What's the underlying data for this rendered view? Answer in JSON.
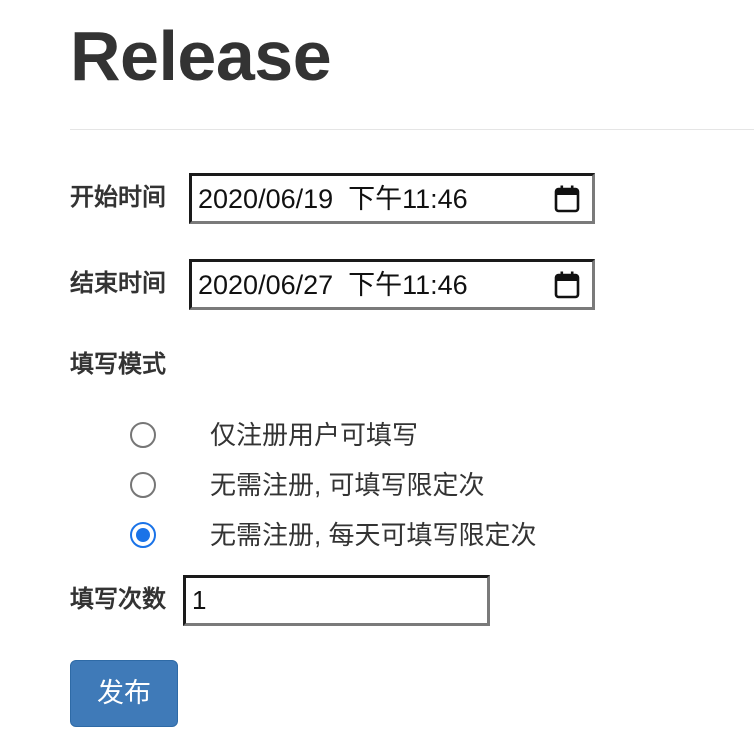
{
  "page": {
    "title": "Release"
  },
  "form": {
    "start_time": {
      "label": "开始时间",
      "value": "2020/06/19  下午11:46"
    },
    "end_time": {
      "label": "结束时间",
      "value": "2020/06/27  下午11:46"
    },
    "fill_mode": {
      "label": "填写模式",
      "options": [
        {
          "label": "仅注册用户可填写",
          "checked": false
        },
        {
          "label": "无需注册, 可填写限定次",
          "checked": false
        },
        {
          "label": "无需注册, 每天可填写限定次",
          "checked": true
        }
      ]
    },
    "fill_count": {
      "label": "填写次数",
      "value": "1"
    },
    "submit_label": "发布"
  },
  "icons": {
    "date_picker": "calendar-icon"
  },
  "colors": {
    "primary_button": "#3f7ab8",
    "radio_selected": "#1a73e8",
    "text": "#333333"
  }
}
